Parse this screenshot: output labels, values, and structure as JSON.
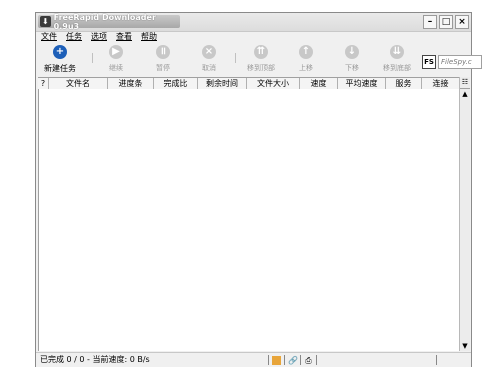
{
  "window": {
    "title": "FreeRapid Downloader 0.9u3"
  },
  "menu": [
    "文件",
    "任务",
    "选项",
    "查看",
    "帮助"
  ],
  "toolbar": [
    {
      "label": "新建任务",
      "icon": "add-icon",
      "active": true
    },
    {
      "label": "继续",
      "icon": "resume-icon",
      "active": false
    },
    {
      "label": "暂停",
      "icon": "pause-icon",
      "active": false
    },
    {
      "label": "取消",
      "icon": "cancel-icon",
      "active": false
    },
    {
      "label": "移到顶部",
      "icon": "move-top-icon",
      "active": false
    },
    {
      "label": "上移",
      "icon": "move-up-icon",
      "active": false
    },
    {
      "label": "下移",
      "icon": "move-down-icon",
      "active": false
    },
    {
      "label": "移到底部",
      "icon": "move-bottom-icon",
      "active": false
    }
  ],
  "filespy": {
    "logo": "FS",
    "placeholder": "FileSpy.c"
  },
  "columns": [
    "?",
    "文件名",
    "进度条",
    "完成比",
    "剩余时间",
    "文件大小",
    "速度",
    "平均速度",
    "服务",
    "连接"
  ],
  "status": {
    "text": "已完成 0 / 0 - 当前速度: 0 B/s"
  }
}
